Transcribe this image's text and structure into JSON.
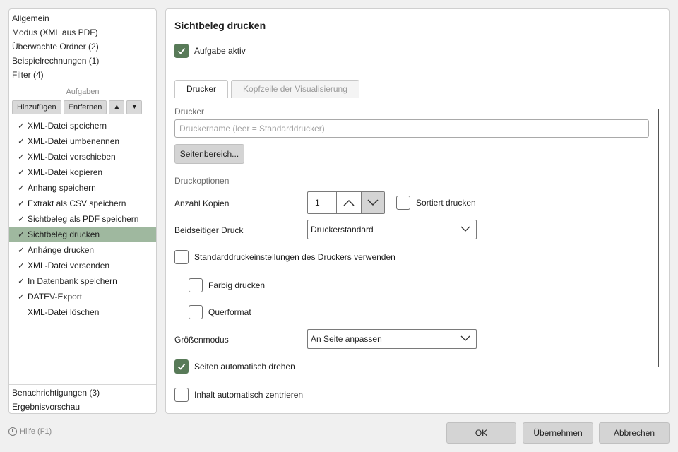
{
  "sidebar": {
    "top_items": [
      "Allgemein",
      "Modus (XML aus PDF)",
      "Überwachte Ordner (2)",
      "Beispielrechnungen (1)",
      "Filter (4)"
    ],
    "tasks_heading": "Aufgaben",
    "buttons": {
      "add": "Hinzufügen",
      "remove": "Entfernen",
      "up": "▲",
      "down": "▼"
    },
    "check_glyph": "✓",
    "tasks": [
      {
        "label": "XML-Datei speichern",
        "checked": true
      },
      {
        "label": "XML-Datei umbenennen",
        "checked": true
      },
      {
        "label": "XML-Datei verschieben",
        "checked": true
      },
      {
        "label": "XML-Datei kopieren",
        "checked": true
      },
      {
        "label": "Anhang speichern",
        "checked": true
      },
      {
        "label": "Extrakt als CSV speichern",
        "checked": true
      },
      {
        "label": "Sichtbeleg als PDF speichern",
        "checked": true
      },
      {
        "label": "Sichtbeleg drucken",
        "checked": true,
        "selected": true
      },
      {
        "label": "Anhänge drucken",
        "checked": true
      },
      {
        "label": "XML-Datei versenden",
        "checked": true
      },
      {
        "label": "In Datenbank speichern",
        "checked": true
      },
      {
        "label": "DATEV-Export",
        "checked": true
      },
      {
        "label": "XML-Datei löschen",
        "checked": false
      }
    ],
    "bottom_items": [
      "Benachrichtigungen (3)",
      "Ergebnisvorschau"
    ]
  },
  "main": {
    "title": "Sichtbeleg drucken",
    "task_active": {
      "label": "Aufgabe aktiv",
      "checked": true
    },
    "tabs": [
      {
        "label": "Drucker",
        "active": true
      },
      {
        "label": "Kopfzeile der Visualisierung",
        "active": false
      }
    ],
    "printer": {
      "section_label": "Drucker",
      "input_placeholder": "Druckername (leer = Standarddrucker)",
      "input_value": "",
      "page_range_button": "Seitenbereich..."
    },
    "options": {
      "section_label": "Druckoptionen",
      "copies_label": "Anzahl Kopien",
      "copies_value": "1",
      "collate": {
        "label": "Sortiert drucken",
        "checked": false
      },
      "duplex_label": "Beidseitiger Druck",
      "duplex_value": "Druckerstandard",
      "use_defaults": {
        "label": "Standarddruckeinstellungen des Druckers verwenden",
        "checked": false
      },
      "color": {
        "label": "Farbig drucken",
        "checked": false
      },
      "landscape": {
        "label": "Querformat",
        "checked": false
      },
      "size_mode_label": "Größenmodus",
      "size_mode_value": "An Seite anpassen",
      "auto_rotate": {
        "label": "Seiten automatisch drehen",
        "checked": true
      },
      "auto_center": {
        "label": "Inhalt automatisch zentrieren",
        "checked": false
      }
    }
  },
  "footer": {
    "help": "Hilfe (F1)",
    "ok": "OK",
    "apply": "Übernehmen",
    "cancel": "Abbrechen"
  },
  "colors": {
    "accent": "#587a58",
    "selection": "#9fb89f"
  }
}
